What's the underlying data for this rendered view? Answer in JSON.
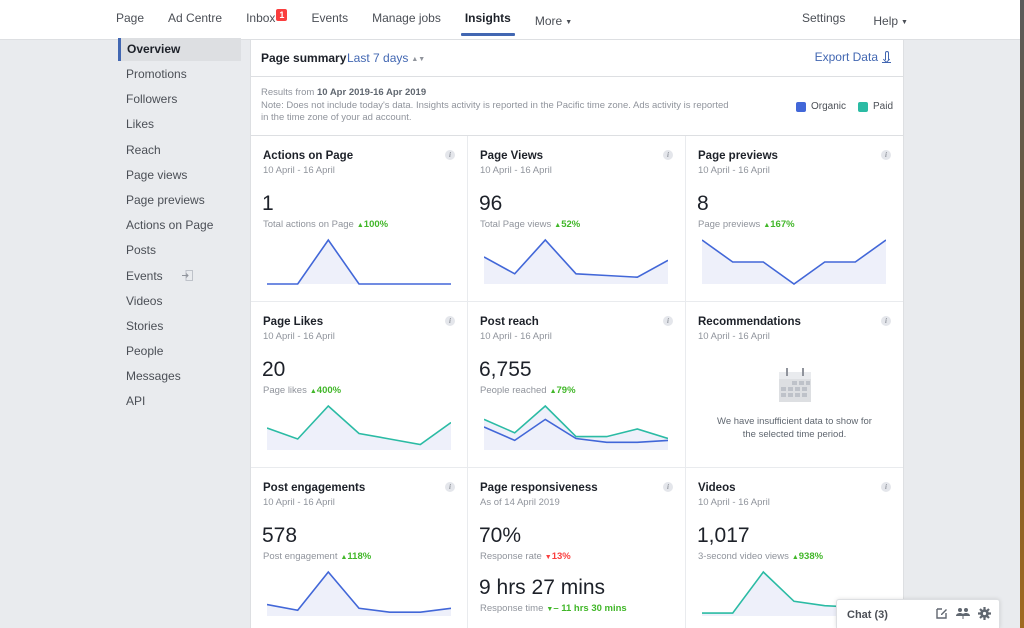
{
  "topnav": {
    "items": [
      {
        "label": "Page"
      },
      {
        "label": "Ad Centre"
      },
      {
        "label": "Inbox",
        "badge": "1"
      },
      {
        "label": "Events"
      },
      {
        "label": "Manage jobs"
      },
      {
        "label": "Insights",
        "active": true
      },
      {
        "label": "More"
      }
    ],
    "right": [
      {
        "label": "Settings"
      },
      {
        "label": "Help"
      }
    ]
  },
  "sidebar": {
    "items": [
      {
        "label": "Overview",
        "active": true
      },
      {
        "label": "Promotions"
      },
      {
        "label": "Followers"
      },
      {
        "label": "Likes"
      },
      {
        "label": "Reach"
      },
      {
        "label": "Page views"
      },
      {
        "label": "Page previews"
      },
      {
        "label": "Actions on Page"
      },
      {
        "label": "Posts"
      },
      {
        "label": "Events",
        "icon": "exit-icon"
      },
      {
        "label": "Videos"
      },
      {
        "label": "Stories"
      },
      {
        "label": "People"
      },
      {
        "label": "Messages"
      },
      {
        "label": "API"
      }
    ]
  },
  "summary": {
    "title": "Page summary",
    "range": "Last 7 days",
    "export": "Export Data",
    "results_prefix": "Results from ",
    "results_range": "10 Apr 2019-16 Apr 2019",
    "note_line1": "Note: Does not include today's data. Insights activity is reported in the Pacific time zone. Ads activity is reported",
    "note_line2": "in the time zone of your ad account.",
    "legend": [
      {
        "label": "Organic",
        "color": "#4267d8"
      },
      {
        "label": "Paid",
        "color": "#2bbba4"
      }
    ]
  },
  "colors": {
    "organic": "#4267d8",
    "paid": "#2bbba4",
    "fill": "#eef0fa",
    "up": "#42b72a",
    "down": "#fa3e3e"
  },
  "cards": [
    {
      "title": "Actions on Page",
      "sub": "10 April - 16 April",
      "value": "1",
      "label": "Total actions on Page",
      "delta": "100%",
      "dir": "up",
      "series": [
        {
          "color": "organic",
          "values": [
            0,
            0,
            1,
            0,
            0,
            0,
            0
          ]
        }
      ]
    },
    {
      "title": "Page Views",
      "sub": "10 April - 16 April",
      "value": "96",
      "label": "Total Page views",
      "delta": "52%",
      "dir": "up",
      "series": [
        {
          "color": "organic",
          "values": [
            16,
            6,
            26,
            6,
            5,
            4,
            14
          ]
        }
      ]
    },
    {
      "title": "Page previews",
      "sub": "10 April - 16 April",
      "value": "8",
      "label": "Page previews",
      "delta": "167%",
      "dir": "up",
      "series": [
        {
          "color": "organic",
          "values": [
            2,
            1,
            1,
            0,
            1,
            1,
            2
          ]
        }
      ]
    },
    {
      "title": "Page Likes",
      "sub": "10 April - 16 April",
      "value": "20",
      "label": "Page likes",
      "delta": "400%",
      "dir": "up",
      "series": [
        {
          "color": "paid",
          "values": [
            4,
            2,
            8,
            3,
            2,
            1,
            5
          ]
        }
      ]
    },
    {
      "title": "Post reach",
      "sub": "10 April - 16 April",
      "value": "6,755",
      "label": "People reached",
      "delta": "79%",
      "dir": "up",
      "series": [
        {
          "color": "paid",
          "values": [
            1600,
            900,
            2300,
            700,
            700,
            1100,
            600
          ]
        },
        {
          "color": "organic",
          "values": [
            1200,
            500,
            1600,
            600,
            400,
            400,
            500
          ]
        }
      ]
    },
    {
      "title": "Recommendations",
      "sub": "10 April - 16 April",
      "empty": "We have insufficient data to show for the selected time period.",
      "empty_line1": "We have insufficient data to show for",
      "empty_line2": "the selected time period."
    },
    {
      "title": "Post engagements",
      "sub": "10 April - 16 April",
      "value": "578",
      "label": "Post engagement",
      "delta": "118%",
      "dir": "up",
      "series": [
        {
          "color": "organic",
          "values": [
            60,
            30,
            230,
            40,
            20,
            20,
            40
          ]
        }
      ]
    },
    {
      "title": "Page responsiveness",
      "sub": "As of 14 April 2019",
      "value": "70%",
      "label": "Response rate",
      "delta": "13%",
      "dir": "down",
      "value2": "9 hrs 27 mins",
      "label2": "Response time",
      "delta2": "– 11 hrs 30 mins",
      "dir2": "down-good"
    },
    {
      "title": "Videos",
      "sub": "10 April - 16 April",
      "value": "1,017",
      "label": "3-second video views",
      "delta": "938%",
      "dir": "up",
      "series": [
        {
          "color": "paid",
          "values": [
            20,
            20,
            300,
            100,
            70,
            60,
            60
          ]
        }
      ]
    }
  ],
  "chat": {
    "label": "Chat (3)"
  }
}
